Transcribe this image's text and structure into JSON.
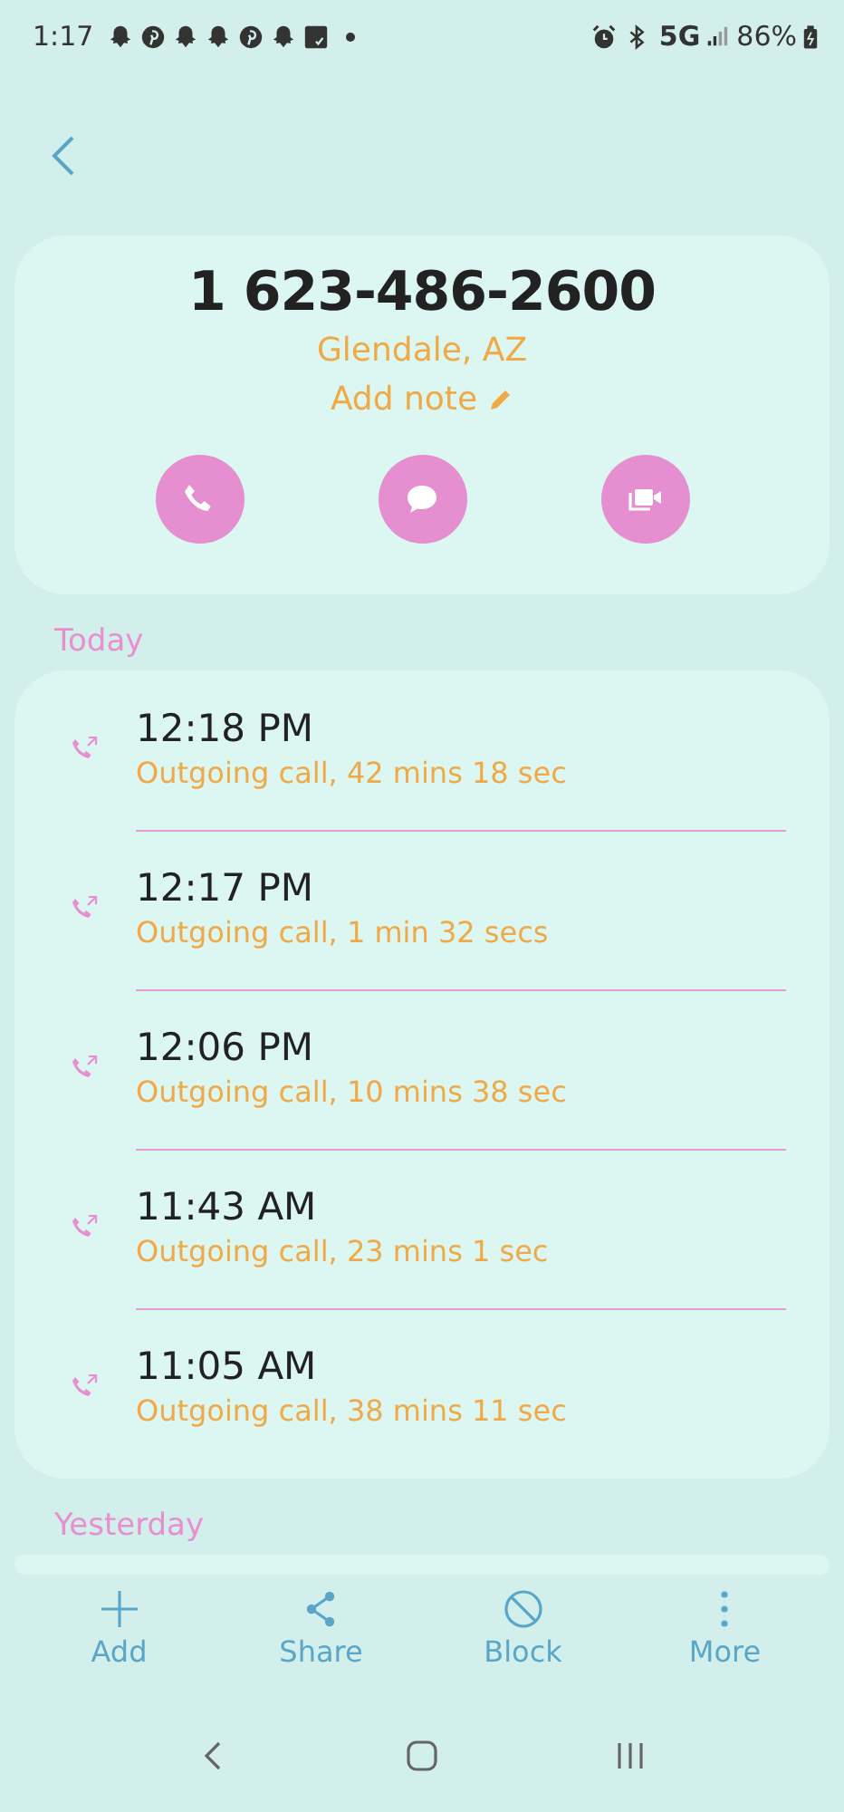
{
  "status_bar": {
    "time": "1:17",
    "notifications": [
      {
        "kind": "ghost"
      },
      {
        "kind": "pin"
      },
      {
        "kind": "ghost"
      },
      {
        "kind": "ghost"
      },
      {
        "kind": "pin"
      },
      {
        "kind": "ghost"
      },
      {
        "kind": "calendar"
      },
      {
        "kind": "dot"
      }
    ],
    "network": "5G",
    "battery": "86%"
  },
  "contact": {
    "number": "1 623-486-2600",
    "location": "Glendale, AZ",
    "note": "Add note",
    "actions": [
      {
        "kind": "call"
      },
      {
        "kind": "message"
      },
      {
        "kind": "video"
      }
    ]
  },
  "sections": [
    {
      "title": "Today",
      "calls": [
        {
          "kind": "outgoing",
          "time": "12:18 PM",
          "detail": "Outgoing call, 42 mins 18 sec"
        },
        {
          "kind": "outgoing",
          "time": "12:17 PM",
          "detail": "Outgoing call, 1 min 32 secs"
        },
        {
          "kind": "outgoing",
          "time": "12:06 PM",
          "detail": "Outgoing call, 10 mins 38 sec"
        },
        {
          "kind": "outgoing",
          "time": "11:43 AM",
          "detail": "Outgoing call, 23 mins 1 sec"
        },
        {
          "kind": "outgoing",
          "time": "11:05 AM",
          "detail": "Outgoing call, 38 mins 11 sec"
        }
      ]
    },
    {
      "title": "Yesterday"
    }
  ],
  "bottom_bar": [
    {
      "kind": "add",
      "label": "Add"
    },
    {
      "kind": "share",
      "label": "Share"
    },
    {
      "kind": "block",
      "label": "Block"
    },
    {
      "kind": "more",
      "label": "More"
    }
  ]
}
